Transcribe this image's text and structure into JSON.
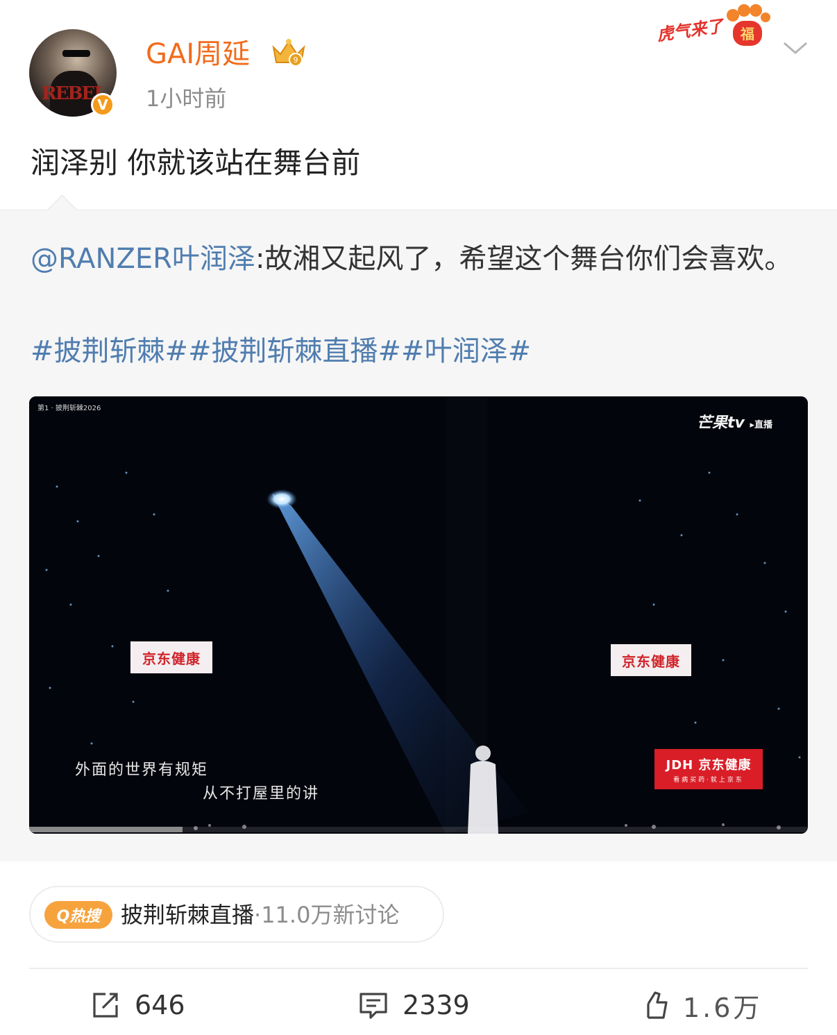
{
  "user": {
    "name": "GAI周延",
    "time": "1小时前",
    "verified_badge": "V",
    "avatar_text": "REBEL"
  },
  "promo": {
    "label": "虎气来了",
    "paw_label": "福"
  },
  "post": {
    "text": "润泽别 你就该站在舞台前"
  },
  "repost": {
    "mention": "@RANZER叶润泽",
    "text": ":故湘又起风了，希望这个舞台你们会喜欢。",
    "hashtags": "#披荆斩棘##披荆斩棘直播##叶润泽#"
  },
  "video": {
    "corner_label": "第1 · 披荆斩棘2026",
    "brand": "芒果tv",
    "brand_suffix": "▸直播",
    "ad_left": "京东健康",
    "ad_right": "京东健康",
    "ad_corner_logo": "JDH 京东健康",
    "ad_corner_tagline": "看病买药·就上京东",
    "lyric_line1": "外面的世界有规矩",
    "lyric_line2": "从不打屋里的讲",
    "progress": 0.197
  },
  "hot_search": {
    "badge": "Q热搜",
    "topic": "披荆斩棘直播",
    "count": "·11.0万新讨论"
  },
  "actions": {
    "share_count": "646",
    "comment_count": "2339",
    "like_count": "1.6万"
  },
  "colors": {
    "username": "#f26b1b",
    "link": "#507daf",
    "hot_badge": "#f6a33d",
    "verified": "#f59a1b"
  }
}
